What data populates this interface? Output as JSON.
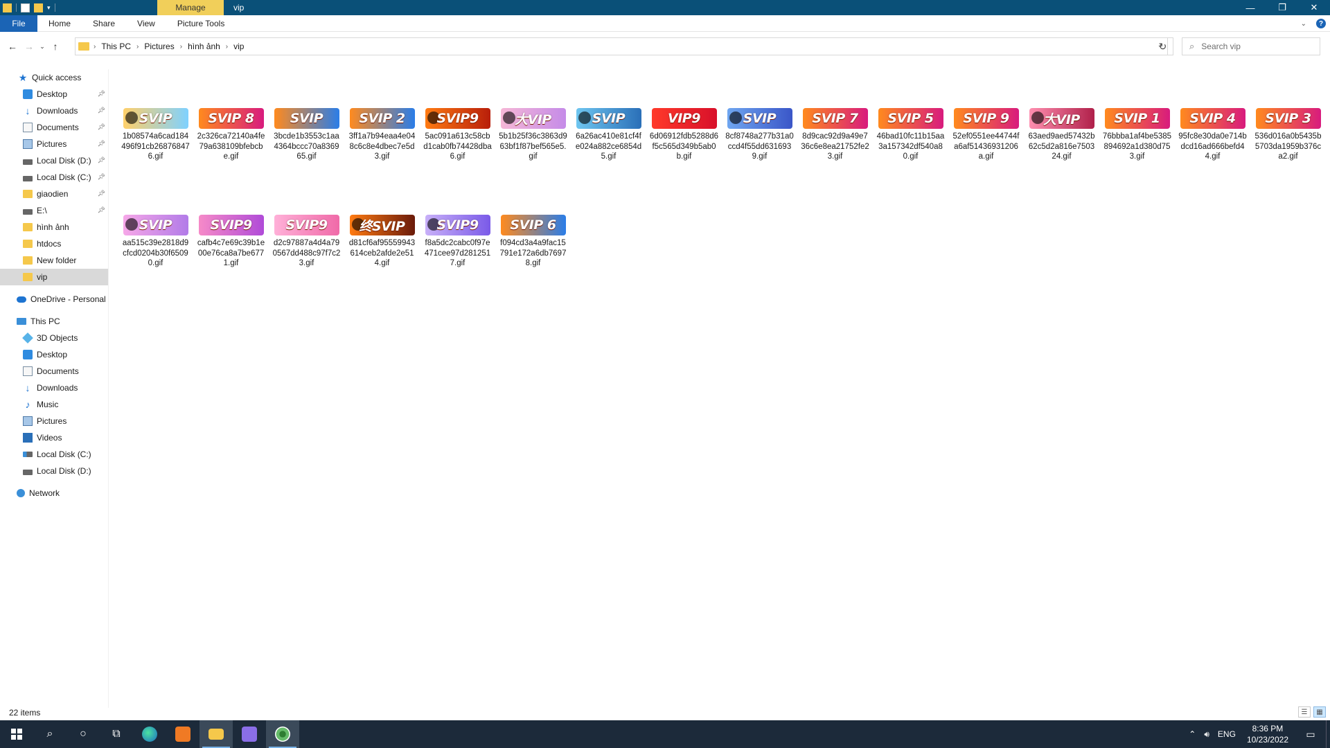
{
  "window": {
    "title": "vip",
    "contextual_tab": "Manage",
    "controls": {
      "minimize": "—",
      "restore": "❐",
      "close": "✕"
    }
  },
  "ribbon": {
    "tabs": [
      "File",
      "Home",
      "Share",
      "View",
      "Picture Tools"
    ]
  },
  "address": {
    "crumbs": [
      "This PC",
      "Pictures",
      "hình ảnh",
      "vip"
    ],
    "search_placeholder": "Search vip"
  },
  "nav": {
    "quick_access": "Quick access",
    "quick_items": [
      {
        "label": "Desktop",
        "icon": "desktop-icon",
        "pinned": true
      },
      {
        "label": "Downloads",
        "icon": "downloads-icon",
        "pinned": true
      },
      {
        "label": "Documents",
        "icon": "documents-icon",
        "pinned": true
      },
      {
        "label": "Pictures",
        "icon": "pictures-icon",
        "pinned": true
      },
      {
        "label": "Local Disk (D:)",
        "icon": "disk-icon",
        "pinned": true
      },
      {
        "label": "Local Disk (C:)",
        "icon": "disk-icon",
        "pinned": true
      },
      {
        "label": "giaodien",
        "icon": "folder-icon",
        "pinned": true
      },
      {
        "label": "E:\\",
        "icon": "disk-icon",
        "pinned": true
      },
      {
        "label": "hình ảnh",
        "icon": "folder-icon",
        "pinned": false
      },
      {
        "label": "htdocs",
        "icon": "folder-icon",
        "pinned": false
      },
      {
        "label": "New folder",
        "icon": "folder-icon",
        "pinned": false
      },
      {
        "label": "vip",
        "icon": "folder-icon",
        "pinned": false,
        "selected": true
      }
    ],
    "onedrive": "OneDrive - Personal",
    "this_pc": "This PC",
    "pc_items": [
      {
        "label": "3D Objects",
        "icon": "3d-objects-icon"
      },
      {
        "label": "Desktop",
        "icon": "desktop-icon"
      },
      {
        "label": "Documents",
        "icon": "documents-icon"
      },
      {
        "label": "Downloads",
        "icon": "downloads-icon"
      },
      {
        "label": "Music",
        "icon": "music-icon"
      },
      {
        "label": "Pictures",
        "icon": "pictures-icon"
      },
      {
        "label": "Videos",
        "icon": "videos-icon"
      },
      {
        "label": "Local Disk (C:)",
        "icon": "disk-c-icon"
      },
      {
        "label": "Local Disk (D:)",
        "icon": "disk-icon"
      }
    ],
    "network": "Network"
  },
  "files": [
    {
      "name": "1b08574a6cad184496f91cb268768476.gif",
      "badge": "SVIP",
      "colors": [
        "#ffd06a",
        "#7fd1ff"
      ],
      "deco": true
    },
    {
      "name": "2c326ca72140a4fe79a638109bfebcbe.gif",
      "badge": "SVIP 8",
      "colors": [
        "#ff8a1e",
        "#d81b7e"
      ]
    },
    {
      "name": "3bcde1b3553c1aa4364bccc70a836965.gif",
      "badge": "SVIP",
      "colors": [
        "#ff8a1e",
        "#2a7de8"
      ]
    },
    {
      "name": "3ff1a7b94eaa4e048c6c8e4dbec7e5d3.gif",
      "badge": "SVIP 2",
      "colors": [
        "#ff8a1e",
        "#2a7de8"
      ]
    },
    {
      "name": "5ac091a613c58cbd1cab0fb74428dba6.gif",
      "badge": "SVIP9",
      "colors": [
        "#ff7b12",
        "#b81e0a"
      ],
      "deco": true
    },
    {
      "name": "5b1b25f36c3863d963bf1f87bef565e5.gif",
      "badge": "大VIP",
      "colors": [
        "#f6b7d6",
        "#c58be8"
      ],
      "deco": true
    },
    {
      "name": "6a26ac410e81cf4fe024a882ce6854d5.gif",
      "badge": "SVIP",
      "colors": [
        "#6fc6f0",
        "#2a6fb8"
      ],
      "deco": true
    },
    {
      "name": "6d06912fdb5288d6f5c565d349b5ab0b.gif",
      "badge": "VIP9",
      "colors": [
        "#ff3a2a",
        "#d8102a"
      ]
    },
    {
      "name": "8cf8748a277b31a0ccd4f55dd6316939.gif",
      "badge": "SVIP",
      "colors": [
        "#6fa6f0",
        "#3a56c8"
      ],
      "deco": true
    },
    {
      "name": "8d9cac92d9a49e736c6e8ea21752fe23.gif",
      "badge": "SVIP 7",
      "colors": [
        "#ff8a1e",
        "#d81b7e"
      ]
    },
    {
      "name": "46bad10fc11b15aa3a157342df540a80.gif",
      "badge": "SVIP 5",
      "colors": [
        "#ff8a1e",
        "#d81b7e"
      ]
    },
    {
      "name": "52ef0551ee44744fa6af51436931206a.gif",
      "badge": "SVIP 9",
      "colors": [
        "#ff8a1e",
        "#d81b7e"
      ]
    },
    {
      "name": "63aed9aed57432b62c5d2a816e750324.gif",
      "badge": "大VIP",
      "colors": [
        "#ff8fb0",
        "#b0204a"
      ],
      "deco": true
    },
    {
      "name": "76bbba1af4be5385894692a1d380d753.gif",
      "badge": "SVIP 1",
      "colors": [
        "#ff8a1e",
        "#d81b7e"
      ]
    },
    {
      "name": "95fc8e30da0e714bdcd16ad666befd44.gif",
      "badge": "SVIP 4",
      "colors": [
        "#ff8a1e",
        "#d81b7e"
      ]
    },
    {
      "name": "536d016a0b5435b5703da1959b376ca2.gif",
      "badge": "SVIP 3",
      "colors": [
        "#ff8a1e",
        "#d81b7e"
      ]
    },
    {
      "name": "aa515c39e2818d9cfcd0204b30f65090.gif",
      "badge": "SVIP",
      "colors": [
        "#f6a7e8",
        "#b27be8"
      ],
      "deco": true
    },
    {
      "name": "cafb4c7e69c39b1e00e76ca8a7be6771.gif",
      "badge": "SVIP9",
      "colors": [
        "#f68ac8",
        "#b04bd8"
      ]
    },
    {
      "name": "d2c97887a4d4a790567dd488c97f7c23.gif",
      "badge": "SVIP9",
      "colors": [
        "#ffb0d8",
        "#f06aa8"
      ]
    },
    {
      "name": "d81cf6af95559943614ceb2afde2e514.gif",
      "badge": "终SVIP",
      "colors": [
        "#ff7b12",
        "#6a1a0a"
      ],
      "deco": true
    },
    {
      "name": "f8a5dc2cabc0f97e471cee97d2812517.gif",
      "badge": "SVIP9",
      "colors": [
        "#c8b0f8",
        "#7a5ae8"
      ],
      "deco": true
    },
    {
      "name": "f094cd3a4a9fac15791e172a6db76978.gif",
      "badge": "SVIP 6",
      "colors": [
        "#ff8a1e",
        "#2a7de8"
      ]
    }
  ],
  "status": {
    "item_count": "22 items"
  },
  "taskbar": {
    "language": "ENG",
    "time": "8:36 PM",
    "date": "10/23/2022"
  }
}
